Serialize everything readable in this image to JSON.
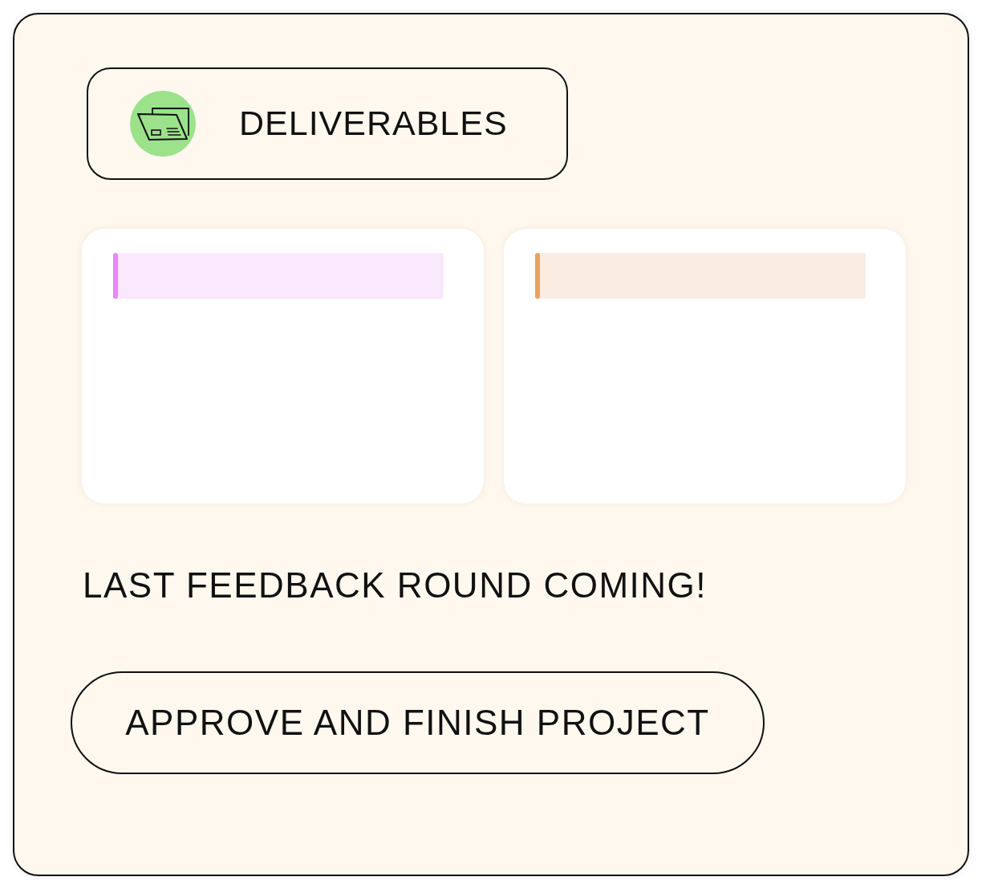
{
  "header": {
    "title": "DELIVERABLES"
  },
  "deliverables": [
    {
      "color": "#e68af5"
    },
    {
      "color": "#e5a264"
    }
  ],
  "message": "LAST FEEDBACK ROUND COMING!",
  "buttons": [
    {
      "label": "APPROVE AND FINISH PROJECT"
    }
  ]
}
